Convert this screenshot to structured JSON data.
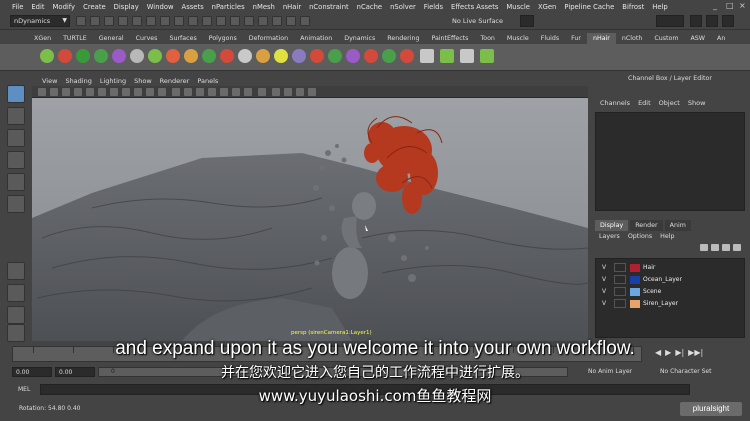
{
  "menubar": {
    "items": [
      "File",
      "Edit",
      "Modify",
      "Create",
      "Display",
      "Window",
      "Assets",
      "nParticles",
      "nMesh",
      "nHair",
      "nConstraint",
      "nCache",
      "nSolver",
      "Fields",
      "Effects Assets",
      "Muscle",
      "XGen",
      "Pipeline Cache",
      "Bifrost",
      "Help"
    ]
  },
  "statusline": {
    "menuset": "nDynamics",
    "live_surface": "No Live Surface"
  },
  "shelf": {
    "tabs": [
      "XGen",
      "TURTLE",
      "General",
      "Curves",
      "Surfaces",
      "Polygons",
      "Deformation",
      "Animation",
      "Dynamics",
      "Rendering",
      "PaintEffects",
      "Toon",
      "Muscle",
      "Fluids",
      "Fur",
      "nHair",
      "nCloth",
      "Custom",
      "ASW",
      "An"
    ],
    "active_tab": "nHair"
  },
  "viewport": {
    "menu": [
      "View",
      "Shading",
      "Lighting",
      "Show",
      "Renderer",
      "Panels"
    ],
    "camera_label": "persp (sirenCamera1:Layer1)"
  },
  "channel_box": {
    "title": "Channel Box / Layer Editor",
    "menu": [
      "Channels",
      "Edit",
      "Object",
      "Show"
    ],
    "tabs": [
      "Display",
      "Render",
      "Anim"
    ],
    "active_tab": "Display",
    "layer_menu": [
      "Layers",
      "Options",
      "Help"
    ],
    "layers": [
      {
        "visible": "V",
        "name": "Hair",
        "color": "#b02030"
      },
      {
        "visible": "V",
        "name": "Ocean_Layer",
        "color": "#1a3fa8"
      },
      {
        "visible": "V",
        "name": "Scene",
        "color": "#6aa6e0"
      },
      {
        "visible": "V",
        "name": "Siren_Layer",
        "color": "#e8a36a"
      }
    ]
  },
  "range": {
    "start_time": "0.00",
    "playback_start": "0.00",
    "bar_value": "0",
    "anim_layer": "No Anim Layer",
    "character_set": "No Character Set"
  },
  "command_line": {
    "label": "MEL"
  },
  "help_line": {
    "text": "Rotation:   54.80   0.40"
  },
  "subtitles": {
    "english": "and expand upon it as you welcome it into your own workflow.",
    "chinese": "并在您欢迎它进入您自己的工作流程中进行扩展。",
    "watermark": "www.yuyulaoshi.com鱼鱼教程网"
  },
  "logo": {
    "text": "pluralsight"
  }
}
